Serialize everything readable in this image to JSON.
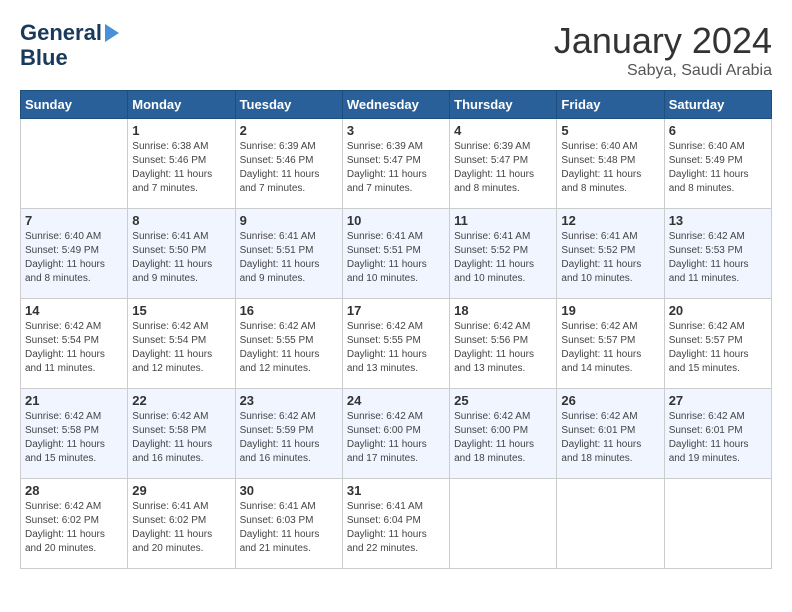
{
  "header": {
    "logo_line1": "General",
    "logo_line2": "Blue",
    "title": "January 2024",
    "location": "Sabya, Saudi Arabia"
  },
  "days_of_week": [
    "Sunday",
    "Monday",
    "Tuesday",
    "Wednesday",
    "Thursday",
    "Friday",
    "Saturday"
  ],
  "weeks": [
    [
      {
        "num": "",
        "empty": true
      },
      {
        "num": "1",
        "sunrise": "Sunrise: 6:38 AM",
        "sunset": "Sunset: 5:46 PM",
        "daylight": "Daylight: 11 hours and 7 minutes."
      },
      {
        "num": "2",
        "sunrise": "Sunrise: 6:39 AM",
        "sunset": "Sunset: 5:46 PM",
        "daylight": "Daylight: 11 hours and 7 minutes."
      },
      {
        "num": "3",
        "sunrise": "Sunrise: 6:39 AM",
        "sunset": "Sunset: 5:47 PM",
        "daylight": "Daylight: 11 hours and 7 minutes."
      },
      {
        "num": "4",
        "sunrise": "Sunrise: 6:39 AM",
        "sunset": "Sunset: 5:47 PM",
        "daylight": "Daylight: 11 hours and 8 minutes."
      },
      {
        "num": "5",
        "sunrise": "Sunrise: 6:40 AM",
        "sunset": "Sunset: 5:48 PM",
        "daylight": "Daylight: 11 hours and 8 minutes."
      },
      {
        "num": "6",
        "sunrise": "Sunrise: 6:40 AM",
        "sunset": "Sunset: 5:49 PM",
        "daylight": "Daylight: 11 hours and 8 minutes."
      }
    ],
    [
      {
        "num": "7",
        "sunrise": "Sunrise: 6:40 AM",
        "sunset": "Sunset: 5:49 PM",
        "daylight": "Daylight: 11 hours and 8 minutes."
      },
      {
        "num": "8",
        "sunrise": "Sunrise: 6:41 AM",
        "sunset": "Sunset: 5:50 PM",
        "daylight": "Daylight: 11 hours and 9 minutes."
      },
      {
        "num": "9",
        "sunrise": "Sunrise: 6:41 AM",
        "sunset": "Sunset: 5:51 PM",
        "daylight": "Daylight: 11 hours and 9 minutes."
      },
      {
        "num": "10",
        "sunrise": "Sunrise: 6:41 AM",
        "sunset": "Sunset: 5:51 PM",
        "daylight": "Daylight: 11 hours and 10 minutes."
      },
      {
        "num": "11",
        "sunrise": "Sunrise: 6:41 AM",
        "sunset": "Sunset: 5:52 PM",
        "daylight": "Daylight: 11 hours and 10 minutes."
      },
      {
        "num": "12",
        "sunrise": "Sunrise: 6:41 AM",
        "sunset": "Sunset: 5:52 PM",
        "daylight": "Daylight: 11 hours and 10 minutes."
      },
      {
        "num": "13",
        "sunrise": "Sunrise: 6:42 AM",
        "sunset": "Sunset: 5:53 PM",
        "daylight": "Daylight: 11 hours and 11 minutes."
      }
    ],
    [
      {
        "num": "14",
        "sunrise": "Sunrise: 6:42 AM",
        "sunset": "Sunset: 5:54 PM",
        "daylight": "Daylight: 11 hours and 11 minutes."
      },
      {
        "num": "15",
        "sunrise": "Sunrise: 6:42 AM",
        "sunset": "Sunset: 5:54 PM",
        "daylight": "Daylight: 11 hours and 12 minutes."
      },
      {
        "num": "16",
        "sunrise": "Sunrise: 6:42 AM",
        "sunset": "Sunset: 5:55 PM",
        "daylight": "Daylight: 11 hours and 12 minutes."
      },
      {
        "num": "17",
        "sunrise": "Sunrise: 6:42 AM",
        "sunset": "Sunset: 5:55 PM",
        "daylight": "Daylight: 11 hours and 13 minutes."
      },
      {
        "num": "18",
        "sunrise": "Sunrise: 6:42 AM",
        "sunset": "Sunset: 5:56 PM",
        "daylight": "Daylight: 11 hours and 13 minutes."
      },
      {
        "num": "19",
        "sunrise": "Sunrise: 6:42 AM",
        "sunset": "Sunset: 5:57 PM",
        "daylight": "Daylight: 11 hours and 14 minutes."
      },
      {
        "num": "20",
        "sunrise": "Sunrise: 6:42 AM",
        "sunset": "Sunset: 5:57 PM",
        "daylight": "Daylight: 11 hours and 15 minutes."
      }
    ],
    [
      {
        "num": "21",
        "sunrise": "Sunrise: 6:42 AM",
        "sunset": "Sunset: 5:58 PM",
        "daylight": "Daylight: 11 hours and 15 minutes."
      },
      {
        "num": "22",
        "sunrise": "Sunrise: 6:42 AM",
        "sunset": "Sunset: 5:58 PM",
        "daylight": "Daylight: 11 hours and 16 minutes."
      },
      {
        "num": "23",
        "sunrise": "Sunrise: 6:42 AM",
        "sunset": "Sunset: 5:59 PM",
        "daylight": "Daylight: 11 hours and 16 minutes."
      },
      {
        "num": "24",
        "sunrise": "Sunrise: 6:42 AM",
        "sunset": "Sunset: 6:00 PM",
        "daylight": "Daylight: 11 hours and 17 minutes."
      },
      {
        "num": "25",
        "sunrise": "Sunrise: 6:42 AM",
        "sunset": "Sunset: 6:00 PM",
        "daylight": "Daylight: 11 hours and 18 minutes."
      },
      {
        "num": "26",
        "sunrise": "Sunrise: 6:42 AM",
        "sunset": "Sunset: 6:01 PM",
        "daylight": "Daylight: 11 hours and 18 minutes."
      },
      {
        "num": "27",
        "sunrise": "Sunrise: 6:42 AM",
        "sunset": "Sunset: 6:01 PM",
        "daylight": "Daylight: 11 hours and 19 minutes."
      }
    ],
    [
      {
        "num": "28",
        "sunrise": "Sunrise: 6:42 AM",
        "sunset": "Sunset: 6:02 PM",
        "daylight": "Daylight: 11 hours and 20 minutes."
      },
      {
        "num": "29",
        "sunrise": "Sunrise: 6:41 AM",
        "sunset": "Sunset: 6:02 PM",
        "daylight": "Daylight: 11 hours and 20 minutes."
      },
      {
        "num": "30",
        "sunrise": "Sunrise: 6:41 AM",
        "sunset": "Sunset: 6:03 PM",
        "daylight": "Daylight: 11 hours and 21 minutes."
      },
      {
        "num": "31",
        "sunrise": "Sunrise: 6:41 AM",
        "sunset": "Sunset: 6:04 PM",
        "daylight": "Daylight: 11 hours and 22 minutes."
      },
      {
        "num": "",
        "empty": true
      },
      {
        "num": "",
        "empty": true
      },
      {
        "num": "",
        "empty": true
      }
    ]
  ]
}
